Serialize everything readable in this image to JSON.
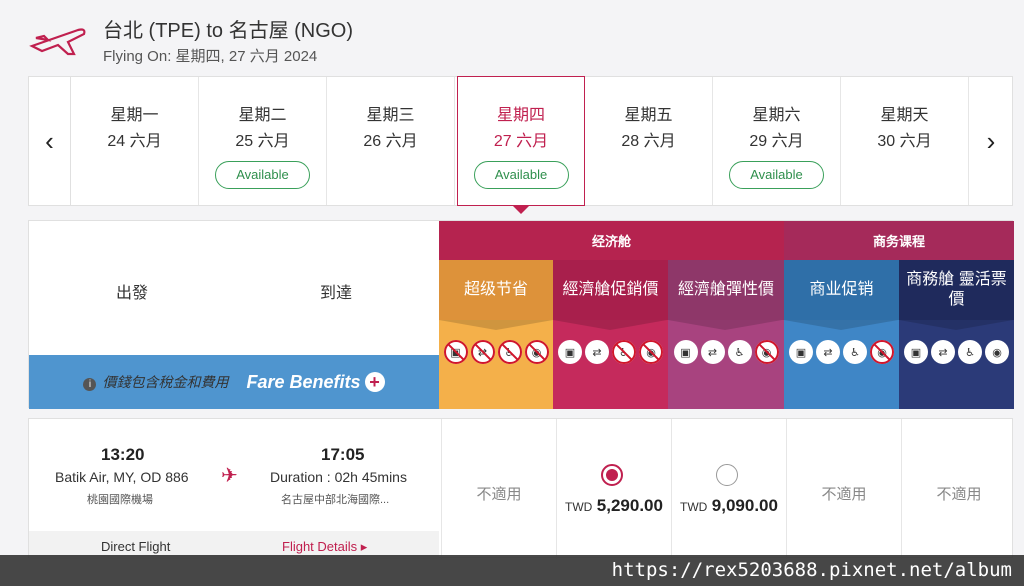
{
  "header": {
    "title": "台北 (TPE) to 名古屋 (NGO)",
    "subtitle": "Flying On: 星期四, 27 六月 2024",
    "brand_color": "#c0204f"
  },
  "dates": [
    {
      "day": "星期一",
      "date": "24 六月",
      "available": ""
    },
    {
      "day": "星期二",
      "date": "25 六月",
      "available": "Available"
    },
    {
      "day": "星期三",
      "date": "26 六月",
      "available": ""
    },
    {
      "day": "星期四",
      "date": "27 六月",
      "available": "Available",
      "selected": true
    },
    {
      "day": "星期五",
      "date": "28 六月",
      "available": ""
    },
    {
      "day": "星期六",
      "date": "29 六月",
      "available": "Available"
    },
    {
      "day": "星期天",
      "date": "30 六月",
      "available": ""
    }
  ],
  "nav": {
    "prev_icon": "chevron-left-icon",
    "next_icon": "chevron-right-icon",
    "prev": "‹",
    "next": "›"
  },
  "table": {
    "depart_label": "出發",
    "arrive_label": "到達",
    "tax_note": "價錢包含稅金和費用",
    "fare_benefits": "Fare Benefits",
    "plus": "+",
    "cabins": [
      {
        "name": "经济舱",
        "color": "#b5234f"
      },
      {
        "name": "商务课程",
        "color": "#a52a5a"
      }
    ],
    "fares": [
      {
        "name": "超级节省",
        "color": "#f0a93c"
      },
      {
        "name": "經濟艙促銷價",
        "color": "#c2255a"
      },
      {
        "name": "經濟艙彈性價",
        "color": "#a6407f"
      },
      {
        "name": "商业促销",
        "color": "#3f86c6"
      },
      {
        "name": "商務艙 靈活票價",
        "color": "#25336a"
      }
    ]
  },
  "flight": {
    "depart_time": "13:20",
    "carrier": "Batik Air, MY, OD 886",
    "depart_airport": "桃園國際機場",
    "arrive_time": "17:05",
    "duration": "Duration : 02h 45mins",
    "arrive_airport": "名古屋中部北海國際...",
    "direct": "Direct Flight",
    "details": "Flight Details",
    "details_arrow": "▸",
    "not_applicable": "不適用",
    "currency": "TWD",
    "price_promo": "5,290.00",
    "price_flex": "9,090.00"
  },
  "watermark": "https://rex5203688.pixnet.net/album"
}
